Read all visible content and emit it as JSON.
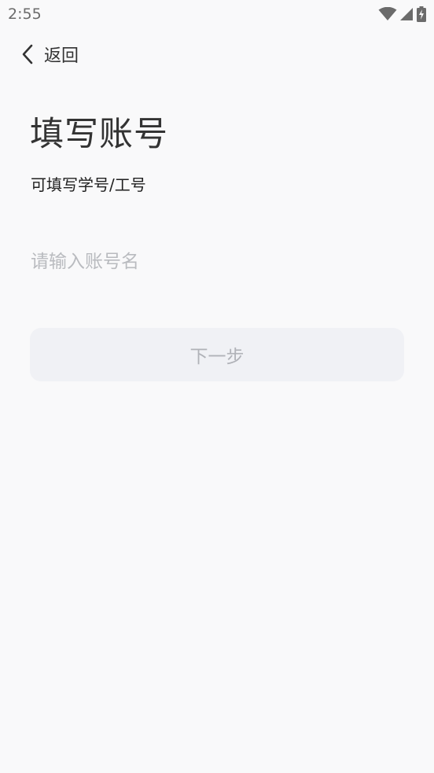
{
  "status_bar": {
    "time": "2:55",
    "icons": [
      "wifi-icon",
      "cellular-signal-icon",
      "battery-charging-icon"
    ]
  },
  "nav": {
    "back_label": "返回",
    "back_icon": "chevron-left-icon"
  },
  "page": {
    "title": "填写账号",
    "subtitle": "可填写学号/工号"
  },
  "form": {
    "account_value": "",
    "account_placeholder": "请输入账号名",
    "next_label": "下一步"
  },
  "colors": {
    "background": "#f9f9fa",
    "button_disabled_bg": "#f0f1f5",
    "button_disabled_text": "#b0b2b8",
    "placeholder": "#b9bbbf"
  }
}
